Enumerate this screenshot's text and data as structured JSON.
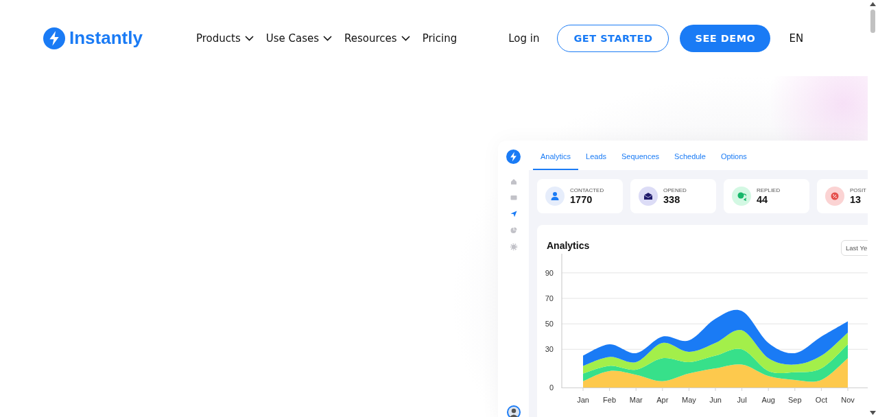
{
  "header": {
    "logo_text": "Instantly",
    "nav": [
      {
        "label": "Products",
        "dropdown": true
      },
      {
        "label": "Use Cases",
        "dropdown": true
      },
      {
        "label": "Resources",
        "dropdown": true
      },
      {
        "label": "Pricing",
        "dropdown": false
      }
    ],
    "login": "Log in",
    "get_started": "GET STARTED",
    "see_demo": "SEE DEMO",
    "language": "EN"
  },
  "dashboard": {
    "sidebar": [
      {
        "selected": false
      },
      {
        "selected": false
      },
      {
        "selected": true
      },
      {
        "selected": false
      },
      {
        "selected": false
      }
    ],
    "tabs": [
      {
        "label": "Analytics",
        "selected": true
      },
      {
        "label": "Leads",
        "selected": false
      },
      {
        "label": "Sequences",
        "selected": false
      },
      {
        "label": "Schedule",
        "selected": false
      },
      {
        "label": "Options",
        "selected": false
      }
    ],
    "stats": [
      {
        "label": "CONTACTED",
        "value": "1770"
      },
      {
        "label": "OPENED",
        "value": "338"
      },
      {
        "label": "REPLIED",
        "value": "44"
      },
      {
        "label": "POSIT",
        "value": "13"
      }
    ],
    "chart": {
      "title": "Analytics",
      "range": "Last Ye",
      "chart_data": {
        "type": "area",
        "stacked": true,
        "categories": [
          "Jan",
          "Feb",
          "Mar",
          "Apr",
          "May",
          "Jun",
          "Jul",
          "Aug",
          "Sep",
          "Oct",
          "Nov"
        ],
        "yticks": [
          0,
          30,
          50,
          70,
          90
        ],
        "ylim": [
          0,
          105
        ],
        "grid": true,
        "series": [
          {
            "color": "#fdc94d",
            "values": [
              5,
              13,
              10,
              5,
              11,
              15,
              18,
              9,
              6,
              6,
              23
            ]
          },
          {
            "color": "#37e08a",
            "values": [
              6,
              4,
              4,
              18,
              9,
              10,
              12,
              4,
              6,
              9,
              11
            ]
          },
          {
            "color": "#a3ef4a",
            "values": [
              6,
              7,
              6,
              12,
              8,
              10,
              15,
              10,
              6,
              10,
              9
            ]
          },
          {
            "color": "#1a7bf5",
            "values": [
              8,
              10,
              7,
              5,
              9,
              19,
              15,
              12,
              9,
              15,
              9
            ]
          }
        ]
      }
    }
  }
}
